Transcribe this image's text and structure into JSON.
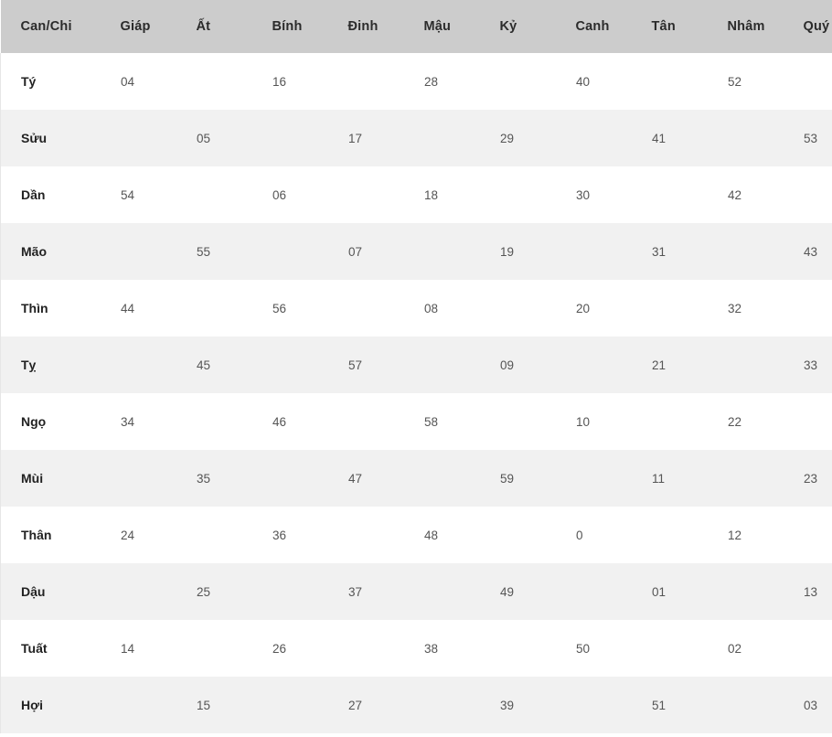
{
  "table": {
    "headers": [
      "Can/Chi",
      "Giáp",
      "Ất",
      "Bính",
      "Đinh",
      "Mậu",
      "Kỷ",
      "Canh",
      "Tân",
      "Nhâm",
      "Quý"
    ],
    "row_labels": [
      "Tý",
      "Sửu",
      "Dần",
      "Mão",
      "Thìn",
      "Tỵ",
      "Ngọ",
      "Mùi",
      "Thân",
      "Dậu",
      "Tuất",
      "Hợi"
    ],
    "rows": [
      {
        "branch": "Tý",
        "cells": [
          "04",
          "",
          "16",
          "",
          "28",
          "",
          "40",
          "",
          "52",
          ""
        ]
      },
      {
        "branch": "Sửu",
        "cells": [
          "",
          "05",
          "",
          "17",
          "",
          "29",
          "",
          "41",
          "",
          "53"
        ]
      },
      {
        "branch": "Dần",
        "cells": [
          "54",
          "",
          "06",
          "",
          "18",
          "",
          "30",
          "",
          "42",
          ""
        ]
      },
      {
        "branch": "Mão",
        "cells": [
          "",
          "55",
          "",
          "07",
          "",
          "19",
          "",
          "31",
          "",
          "43"
        ]
      },
      {
        "branch": "Thìn",
        "cells": [
          "44",
          "",
          "56",
          "",
          "08",
          "",
          "20",
          "",
          "32",
          ""
        ]
      },
      {
        "branch": "Tỵ",
        "cells": [
          "",
          "45",
          "",
          "57",
          "",
          "09",
          "",
          "21",
          "",
          "33"
        ]
      },
      {
        "branch": "Ngọ",
        "cells": [
          "34",
          "",
          "46",
          "",
          "58",
          "",
          "10",
          "",
          "22",
          ""
        ]
      },
      {
        "branch": "Mùi",
        "cells": [
          "",
          "35",
          "",
          "47",
          "",
          "59",
          "",
          "11",
          "",
          "23"
        ]
      },
      {
        "branch": "Thân",
        "cells": [
          "24",
          "",
          "36",
          "",
          "48",
          "",
          "0",
          "",
          "12",
          ""
        ]
      },
      {
        "branch": "Dậu",
        "cells": [
          "",
          "25",
          "",
          "37",
          "",
          "49",
          "",
          "01",
          "",
          "13"
        ]
      },
      {
        "branch": "Tuất",
        "cells": [
          "14",
          "",
          "26",
          "",
          "38",
          "",
          "50",
          "",
          "02",
          ""
        ]
      },
      {
        "branch": "Hợi",
        "cells": [
          "",
          "15",
          "",
          "27",
          "",
          "39",
          "",
          "51",
          "",
          "03"
        ]
      }
    ]
  },
  "colors": {
    "header_background": "#cccccc",
    "header_text": "#2b2b2b",
    "row_odd_background": "#ffffff",
    "row_even_background": "#f1f1f1",
    "cell_text": "#555555",
    "branch_text": "#222222"
  }
}
